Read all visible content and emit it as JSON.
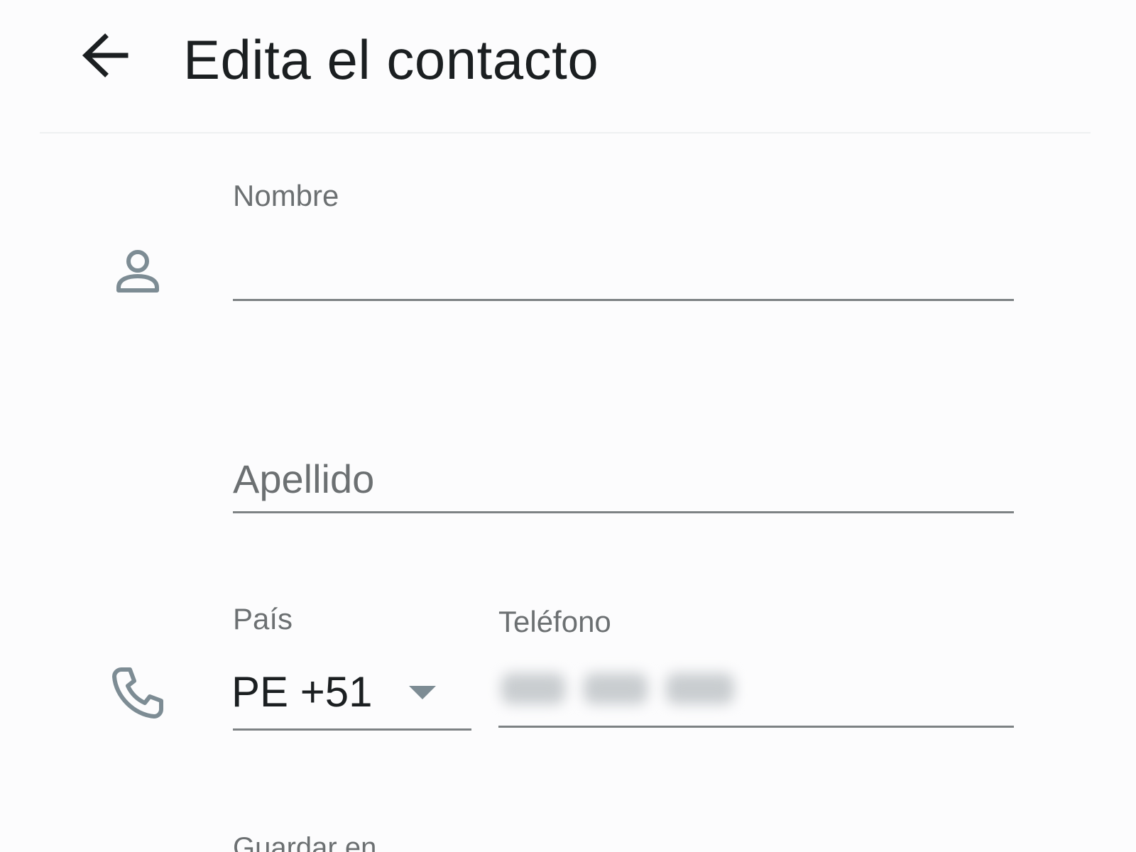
{
  "header": {
    "title": "Edita el contacto",
    "back_icon": "arrow-left-icon"
  },
  "name_section": {
    "icon": "person-icon",
    "first_name_label": "Nombre",
    "first_name_value": "",
    "last_name_placeholder": "Apellido",
    "last_name_value": ""
  },
  "phone_section": {
    "icon": "phone-icon",
    "country_label": "País",
    "country_value": "PE +51",
    "phone_label": "Teléfono",
    "phone_value_redacted": true
  },
  "save_section": {
    "label": "Guardar en"
  },
  "colors": {
    "background": "#fcfcfd",
    "text_primary": "#1b1f21",
    "label_gray": "#6c7072",
    "underline_gray": "#7d8284",
    "icon_gray": "#7d8c94"
  }
}
